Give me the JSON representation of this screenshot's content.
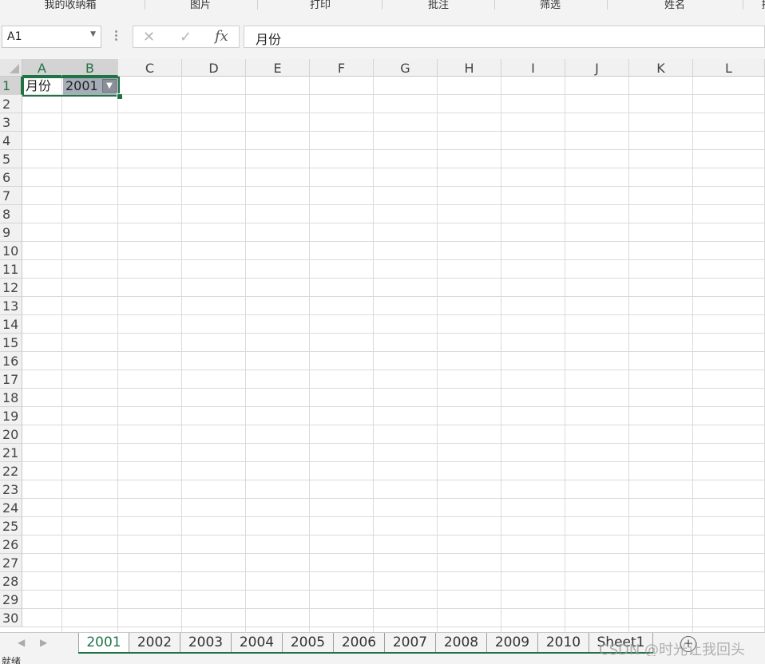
{
  "ribbon": {
    "groups": [
      "我的收纳箱",
      "图片",
      "打印",
      "批注",
      "筛选",
      "姓名",
      "排"
    ]
  },
  "formula_bar": {
    "name_box": "A1",
    "cancel_glyph": "✕",
    "enter_glyph": "✓",
    "fx_label": "fx",
    "value": "月份"
  },
  "grid": {
    "columns": [
      "A",
      "B",
      "C",
      "D",
      "E",
      "F",
      "G",
      "H",
      "I",
      "J",
      "K",
      "L"
    ],
    "rows": [
      "1",
      "2",
      "3",
      "4",
      "5",
      "6",
      "7",
      "8",
      "9",
      "10",
      "11",
      "12",
      "13",
      "14",
      "15",
      "16",
      "17",
      "18",
      "19",
      "20",
      "21",
      "22",
      "23",
      "24",
      "25",
      "26",
      "27",
      "28",
      "29",
      "30"
    ],
    "cells": {
      "A1": "月份",
      "B1": "2001"
    },
    "selected_cell": "A1"
  },
  "sheet_tabs": {
    "tabs": [
      "2001",
      "2002",
      "2003",
      "2004",
      "2005",
      "2006",
      "2007",
      "2008",
      "2009",
      "2010",
      "Sheet1"
    ],
    "active": "2001",
    "add_glyph": "+"
  },
  "watermark": "CSDN @时光让我回头",
  "status_bar": {
    "text": "就绪"
  },
  "colors": {
    "accent": "#217346",
    "filtered_cell": "#a5adb8"
  }
}
